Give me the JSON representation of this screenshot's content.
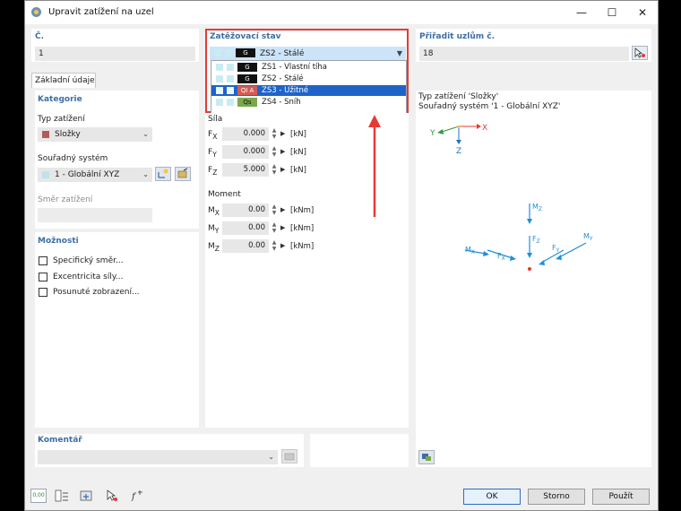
{
  "window": {
    "title": "Upravit zatížení na uzel",
    "minimize": "—",
    "maximize": "☐",
    "close": "✕"
  },
  "number": {
    "label": "Č.",
    "value": "1"
  },
  "load_case": {
    "label": "Zatěžovací stav",
    "selected": {
      "badge": "G",
      "text": "ZS2 - Stálé"
    },
    "items": [
      {
        "badge": "G",
        "text": "ZS1 - Vlastní tíha",
        "badge_color": "#111111"
      },
      {
        "badge": "G",
        "text": "ZS2 - Stálé",
        "badge_color": "#111111"
      },
      {
        "badge": "QI A",
        "text": "ZS3 - Užitné",
        "badge_color": "#d35b55"
      },
      {
        "badge": "Qs",
        "text": "ZS4 - Sníh",
        "badge_color": "#7aa84a"
      }
    ]
  },
  "assign_nodes": {
    "label": "Přiřadit uzlům č.",
    "value": "18"
  },
  "tab": {
    "label": "Základní údaje"
  },
  "category": {
    "heading": "Kategorie",
    "load_type_label": "Typ zatížení",
    "load_type_value": "Složky",
    "coord_label": "Souřadný systém",
    "coord_value": "1 - Globální XYZ",
    "direction_label": "Směr zatížení"
  },
  "options": {
    "heading": "Možnosti",
    "items": [
      "Specifický směr...",
      "Excentricita síly...",
      "Posunuté zobrazení..."
    ]
  },
  "force": {
    "heading": "Síla",
    "rows": [
      {
        "name": "F",
        "sub": "X",
        "value": "0.000",
        "unit": "[kN]"
      },
      {
        "name": "F",
        "sub": "Y",
        "value": "0.000",
        "unit": "[kN]"
      },
      {
        "name": "F",
        "sub": "Z",
        "value": "5.000",
        "unit": "[kN]"
      }
    ]
  },
  "moment": {
    "heading": "Moment",
    "rows": [
      {
        "name": "M",
        "sub": "X",
        "value": "0.00",
        "unit": "[kNm]"
      },
      {
        "name": "M",
        "sub": "Y",
        "value": "0.00",
        "unit": "[kNm]"
      },
      {
        "name": "M",
        "sub": "Z",
        "value": "0.00",
        "unit": "[kNm]"
      }
    ]
  },
  "preview": {
    "line1": "Typ zatížení 'Složky'",
    "line2": "Souřadný systém '1 - Globální XYZ'",
    "axes": {
      "x": "X",
      "y": "Y",
      "z": "Z"
    },
    "labels": {
      "mz": "M",
      "mz_sub": "Z",
      "fz": "F",
      "fz_sub": "Z",
      "my": "M",
      "my_sub": "Y",
      "fy": "F",
      "fy_sub": "Y",
      "mx": "M",
      "mx_sub": "X",
      "fx": "F",
      "fx_sub": "X"
    }
  },
  "comment": {
    "label": "Komentář"
  },
  "buttons": {
    "ok": "OK",
    "cancel": "Storno",
    "apply": "Použít"
  },
  "bottom_icon_text": "0,00"
}
